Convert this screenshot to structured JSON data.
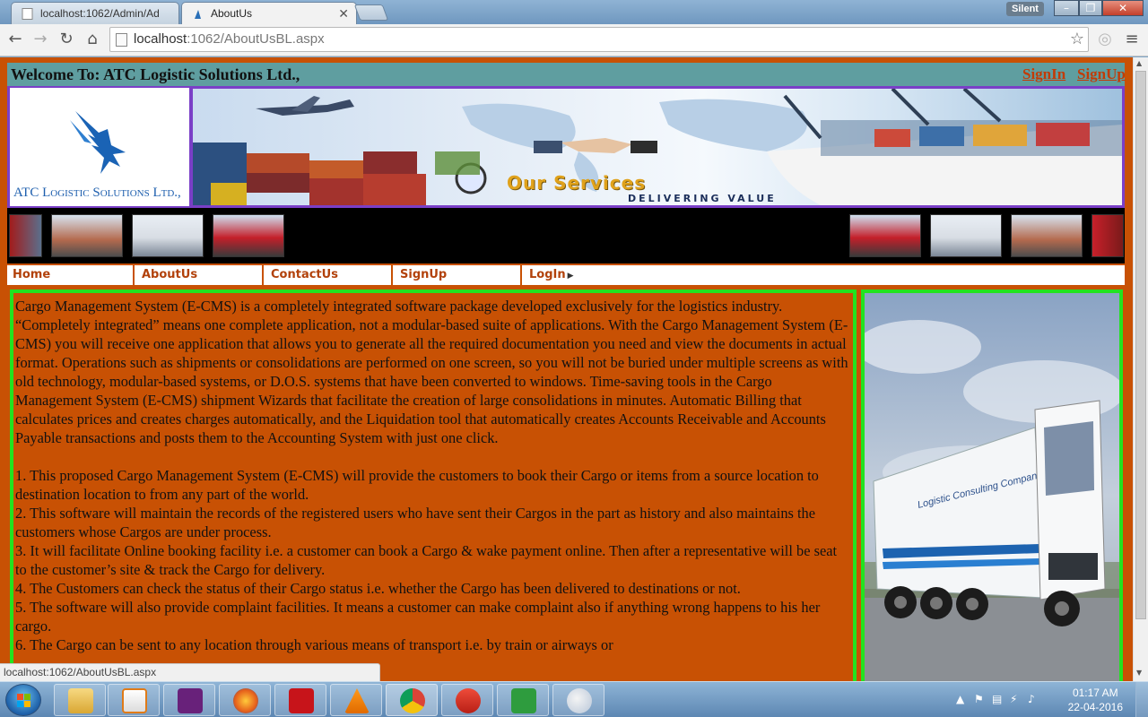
{
  "browser": {
    "tabs": [
      {
        "title": "localhost:1062/Admin/Ad",
        "active": false
      },
      {
        "title": "AboutUs",
        "active": true
      }
    ],
    "profile_badge": "Silent",
    "url_host": "localhost",
    "url_rest": ":1062/AboutUsBL.aspx",
    "status_url": "localhost:1062/AboutUsBL.aspx"
  },
  "page": {
    "welcome_text": "Welcome To: ATC Logistic Solutions Ltd.,",
    "signin_label": "SignIn",
    "signup_label": "SignUp",
    "logo_text": "ATC Logistic Solutions Ltd.,",
    "banner_services": "Our Services",
    "banner_tagline": "DELIVERING VALUE",
    "menu": [
      {
        "label": "Home"
      },
      {
        "label": "AboutUs"
      },
      {
        "label": "ContactUs"
      },
      {
        "label": "SignUp"
      },
      {
        "label": "LogIn"
      }
    ],
    "intro": "Cargo Management System (E-CMS) is a completely integrated software package developed exclusively for the logistics industry. “Completely integrated” means one complete application, not a modular-based suite of applications. With the Cargo Management System (E-CMS) you will receive one application that allows you to generate all the required documentation you need and view the documents in actual format. Operations such as shipments or consolidations are performed on one screen, so you will not be buried under multiple screens as with old technology, modular-based systems, or D.O.S. systems that have been converted to windows. Time-saving tools in the Cargo Management System (E-CMS) shipment Wizards that facilitate the creation of large consolidations in minutes. Automatic Billing that calculates prices and creates charges automatically, and the Liquidation tool that automatically creates Accounts Receivable and Accounts Payable transactions and posts them to the Accounting System with just one click.",
    "points": [
      "1.  This proposed Cargo Management System (E-CMS) will provide the customers to book their Cargo or items from a source location to destination location to from any part of the world.",
      "2.  This software will maintain the records of the registered users who have sent their Cargos in the part as history and also maintains the customers whose Cargos are under process.",
      "3.  It will facilitate Online booking facility i.e. a customer can book a Cargo & wake payment online. Then after a representative will be seat to the customer’s site & track the Cargo for delivery.",
      "4.  The Customers can check the status of their Cargo status i.e. whether the Cargo has been delivered to destinations or not.",
      "5.  The software will also provide complaint facilities. It means a customer can make complaint also if anything wrong happens to his her cargo.",
      "6.  The Cargo can be sent to any location through various means of transport i.e. by train or airways or"
    ],
    "truck_side_text": "Logistic Consulting Company"
  },
  "taskbar": {
    "time": "01:17 AM",
    "date": "22-04-2016"
  },
  "colors": {
    "page_bg": "#c85104",
    "welcome_bar": "#5f9ea0",
    "content_border": "#22e31f",
    "link": "#c23b06"
  }
}
